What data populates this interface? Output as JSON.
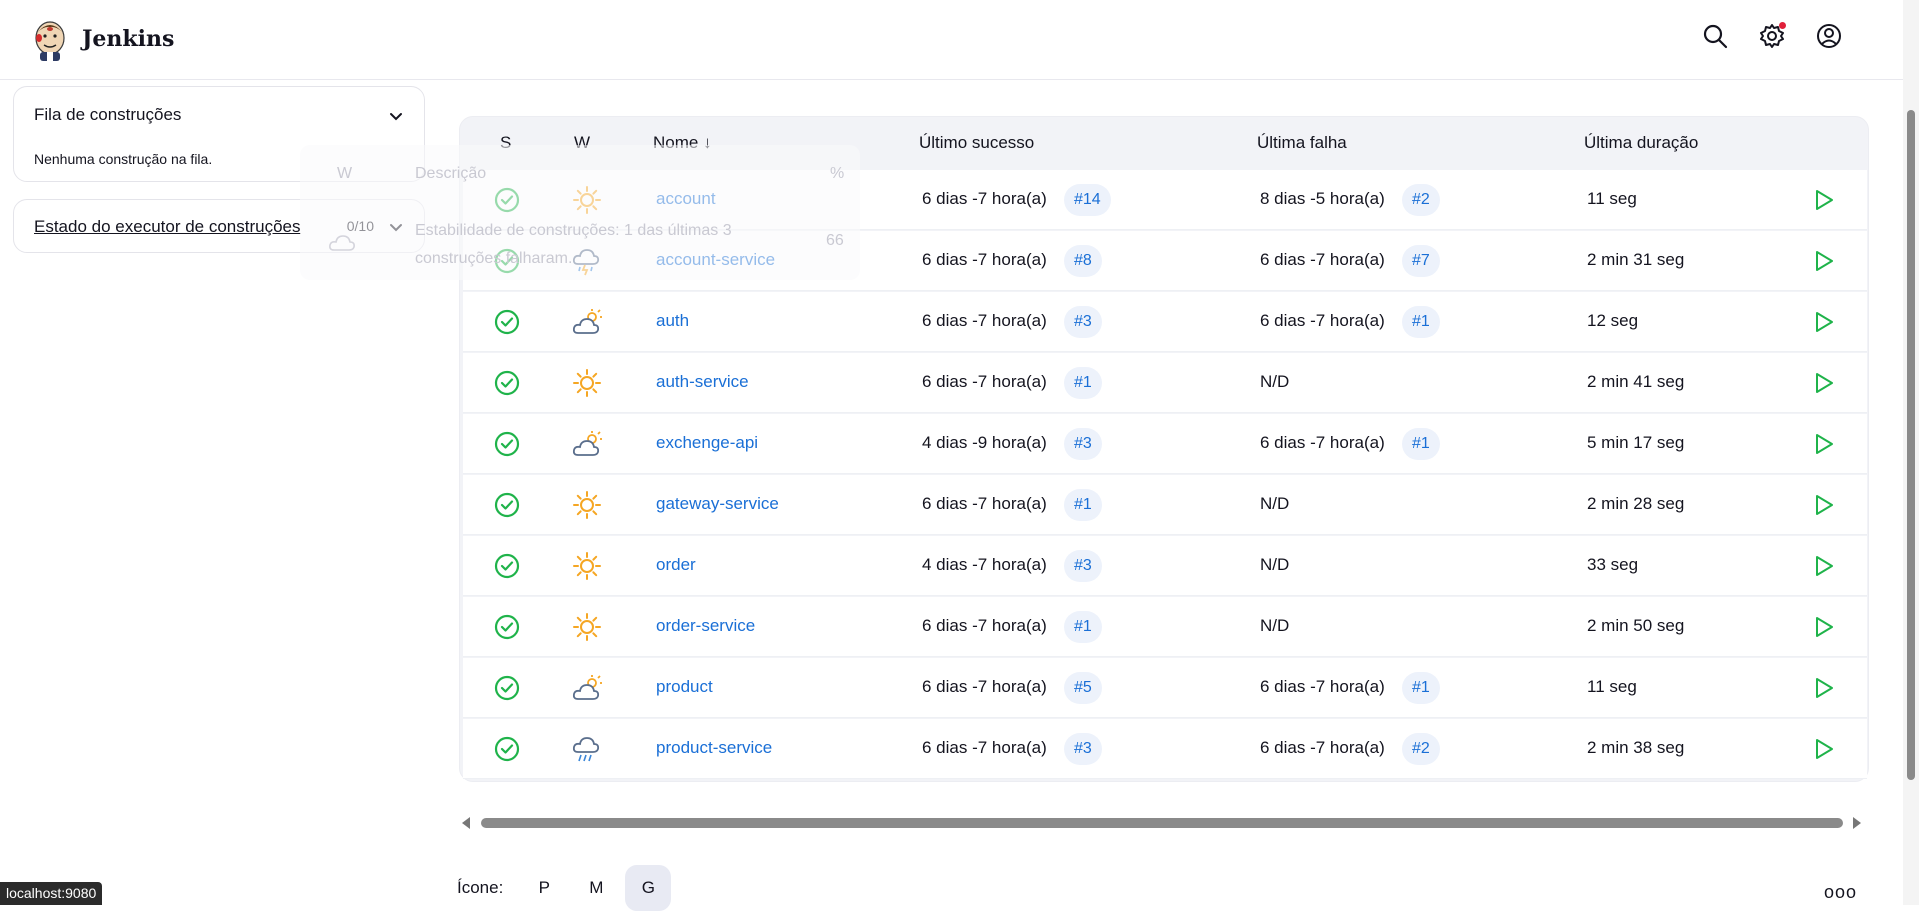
{
  "header": {
    "title": "Jenkins",
    "notification_color": "#e0203a"
  },
  "sidebar": {
    "queue": {
      "title": "Fila de construções",
      "empty_text": "Nenhuma construção na fila."
    },
    "executor": {
      "title": "Estado do executor de construções",
      "count": "0/10"
    }
  },
  "tooltip": {
    "col_w": "W",
    "col_desc": "Descrição",
    "col_pct": "%",
    "description": "Estabilidade de construções: 1 das últimas 3 construções falharam.",
    "value": "66",
    "icon": "cloudy-icon"
  },
  "table": {
    "headers": {
      "s": "S",
      "w": "W",
      "name": "Nome ↓",
      "last_success": "Último sucesso",
      "last_failure": "Última falha",
      "last_duration": "Última duração"
    },
    "rows": [
      {
        "name": "account",
        "weather": "sunny",
        "ok": "6 dias -7 hora(a)",
        "ok_build": "#14",
        "fail": "8 dias -5 hora(a)",
        "fail_build": "#2",
        "duration": "11 seg"
      },
      {
        "name": "account-service",
        "weather": "storm",
        "ok": "6 dias -7 hora(a)",
        "ok_build": "#8",
        "fail": "6 dias -7 hora(a)",
        "fail_build": "#7",
        "duration": "2 min 31 seg"
      },
      {
        "name": "auth",
        "weather": "partly-cloudy",
        "ok": "6 dias -7 hora(a)",
        "ok_build": "#3",
        "fail": "6 dias -7 hora(a)",
        "fail_build": "#1",
        "duration": "12 seg"
      },
      {
        "name": "auth-service",
        "weather": "sunny",
        "ok": "6 dias -7 hora(a)",
        "ok_build": "#1",
        "fail": "N/D",
        "fail_build": "",
        "duration": "2 min 41 seg"
      },
      {
        "name": "exchenge-api",
        "weather": "partly-cloudy",
        "ok": "4 dias -9 hora(a)",
        "ok_build": "#3",
        "fail": "6 dias -7 hora(a)",
        "fail_build": "#1",
        "duration": "5 min 17 seg"
      },
      {
        "name": "gateway-service",
        "weather": "sunny",
        "ok": "6 dias -7 hora(a)",
        "ok_build": "#1",
        "fail": "N/D",
        "fail_build": "",
        "duration": "2 min 28 seg"
      },
      {
        "name": "order",
        "weather": "sunny",
        "ok": "4 dias -7 hora(a)",
        "ok_build": "#3",
        "fail": "N/D",
        "fail_build": "",
        "duration": "33 seg"
      },
      {
        "name": "order-service",
        "weather": "sunny",
        "ok": "6 dias -7 hora(a)",
        "ok_build": "#1",
        "fail": "N/D",
        "fail_build": "",
        "duration": "2 min 50 seg"
      },
      {
        "name": "product",
        "weather": "partly-cloudy",
        "ok": "6 dias -7 hora(a)",
        "ok_build": "#5",
        "fail": "6 dias -7 hora(a)",
        "fail_build": "#1",
        "duration": "11 seg"
      },
      {
        "name": "product-service",
        "weather": "rain",
        "ok": "6 dias -7 hora(a)",
        "ok_build": "#3",
        "fail": "6 dias -7 hora(a)",
        "fail_build": "#2",
        "duration": "2 min 38 seg"
      }
    ]
  },
  "icon_size": {
    "label": "Ícone:",
    "options": [
      "P",
      "M",
      "G"
    ],
    "selected": "G"
  },
  "more_label": "ooo",
  "status_url": "localhost:9080",
  "colors": {
    "success": "#1fb34a",
    "sun": "#f5a623",
    "link": "#1a6fd6"
  }
}
